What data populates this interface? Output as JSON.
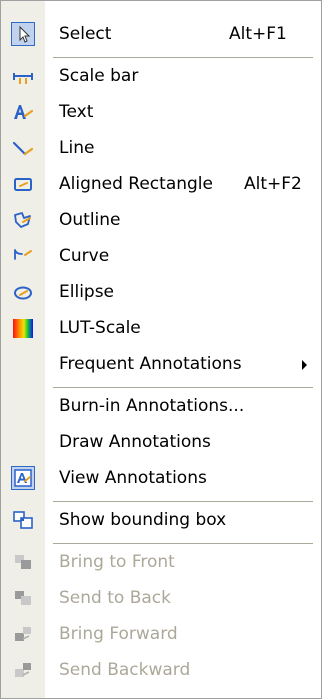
{
  "menu": {
    "items": [
      {
        "label": "Select",
        "shortcut": "Alt+F1",
        "icon": "pointer-arrow-icon"
      },
      {
        "label": "Scale bar",
        "icon": "scale-bar-icon"
      },
      {
        "label": "Text",
        "icon": "text-annotation-icon"
      },
      {
        "label": "Line",
        "icon": "line-tool-icon"
      },
      {
        "label": "Aligned Rectangle",
        "shortcut": "Alt+F2",
        "icon": "aligned-rectangle-icon"
      },
      {
        "label": "Outline",
        "icon": "outline-tool-icon"
      },
      {
        "label": "Curve",
        "icon": "curve-tool-icon"
      },
      {
        "label": "Ellipse",
        "icon": "ellipse-tool-icon"
      },
      {
        "label": "LUT-Scale",
        "icon": "lut-scale-icon"
      },
      {
        "label": "Frequent Annotations",
        "icon": "submenu-arrow-icon"
      },
      {
        "label": "Burn-in Annotations..."
      },
      {
        "label": "Draw Annotations"
      },
      {
        "label": "View Annotations",
        "icon": "view-annotations-icon"
      },
      {
        "label": "Show bounding box",
        "icon": "bounding-box-icon"
      },
      {
        "label": "Bring to Front",
        "icon": "bring-to-front-icon"
      },
      {
        "label": "Send to Back",
        "icon": "send-to-back-icon"
      },
      {
        "label": "Bring Forward",
        "icon": "bring-forward-icon"
      },
      {
        "label": "Send Backward",
        "icon": "send-backward-icon"
      }
    ]
  },
  "colors": {
    "gutter": "#f0efe7",
    "separator": "#aca899",
    "disabled_text": "#aca899",
    "checked_icon_border": "#316ac5",
    "icon_blue": "#2b62c8",
    "icon_orange": "#e8a020"
  }
}
